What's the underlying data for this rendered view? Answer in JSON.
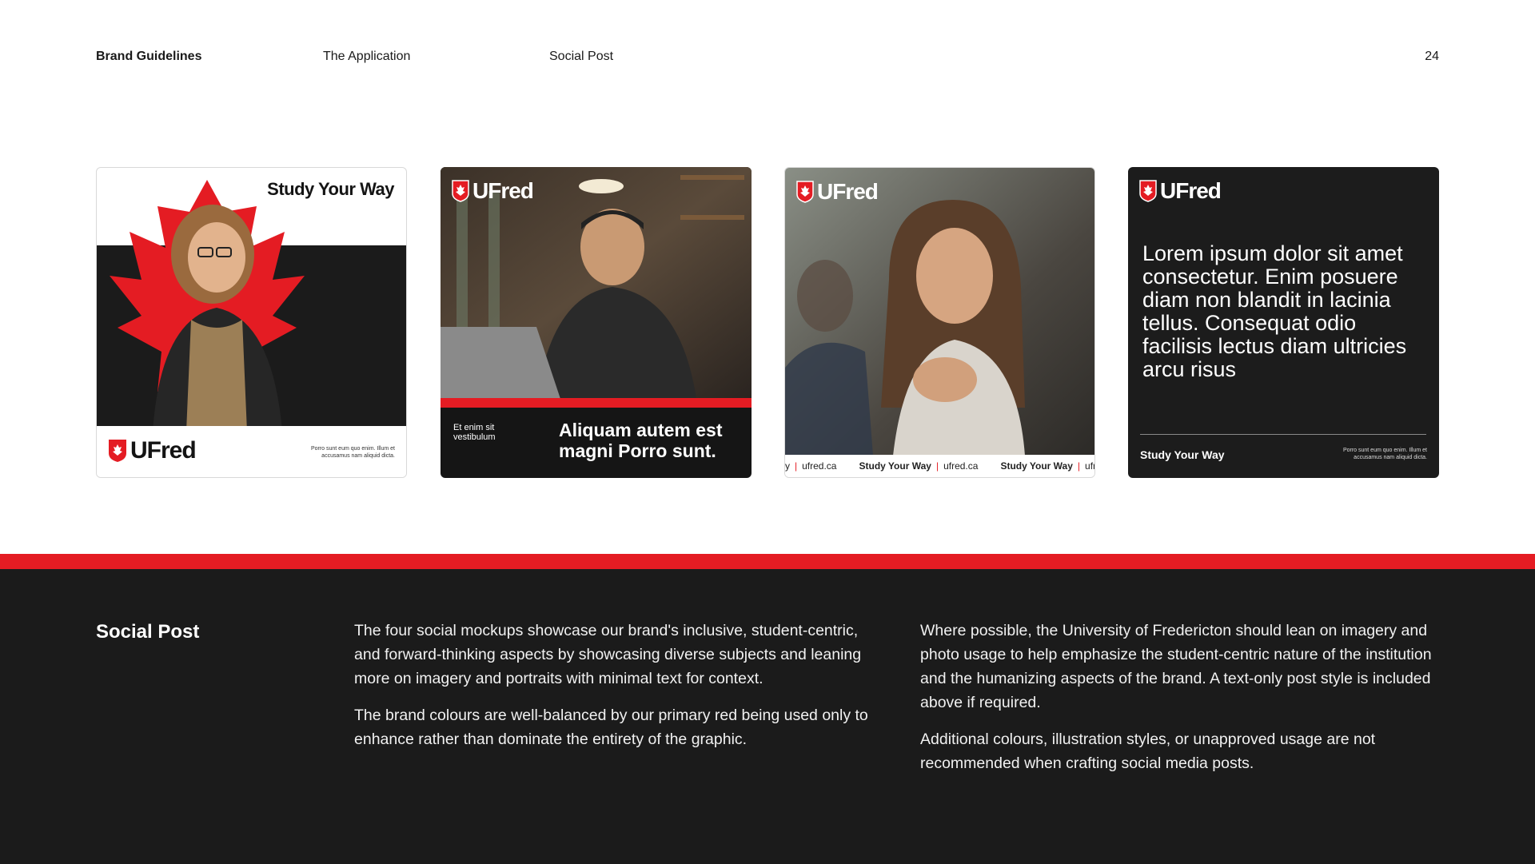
{
  "header": {
    "brand": "Brand Guidelines",
    "section": "The Application",
    "subsection": "Social Post",
    "page_number": "24"
  },
  "colors": {
    "red": "#e41c23",
    "dark": "#1b1b1b",
    "white": "#ffffff"
  },
  "cards": {
    "card1": {
      "title": "Study Your Way",
      "logo": "UFred",
      "small_text": "Porro sunt eum quo enim. Illum et accusamus nam aliquid dicta."
    },
    "card2": {
      "logo": "UFred",
      "small_text": "Et enim sit vestibulum",
      "headline": "Aliquam autem est magni Porro sunt."
    },
    "card3": {
      "logo": "UFred",
      "ticker": {
        "url": "ufred.ca",
        "tagline": "Study Your Way",
        "lead": "y",
        "tail": "ufr"
      }
    },
    "card4": {
      "logo": "UFred",
      "body": "Lorem ipsum dolor sit amet consectetur. Enim posuere diam non blandit in lacinia tellus. Consequat odio facilisis lectus diam ultricies arcu risus",
      "tagline": "Study Your Way",
      "small_text": "Porro sunt eum quo enim. Illum et accusamus nam aliquid dicta."
    }
  },
  "section": {
    "title": "Social Post",
    "col1": [
      "The four social mockups showcase our brand's inclusive, student-centric, and forward-thinking aspects by showcasing diverse subjects and leaning more on imagery and portraits with minimal text for context.",
      "The brand colours are well-balanced by our primary red being used only to enhance rather than dominate the entirety of the graphic."
    ],
    "col2": [
      "Where possible, the University of Fredericton should lean on imagery and photo usage to help emphasize the student-centric nature of the institution and the humanizing aspects of the brand. A text-only post style is included above if required.",
      "Additional colours, illustration styles, or unapproved usage are not recommended when crafting social media posts."
    ]
  }
}
